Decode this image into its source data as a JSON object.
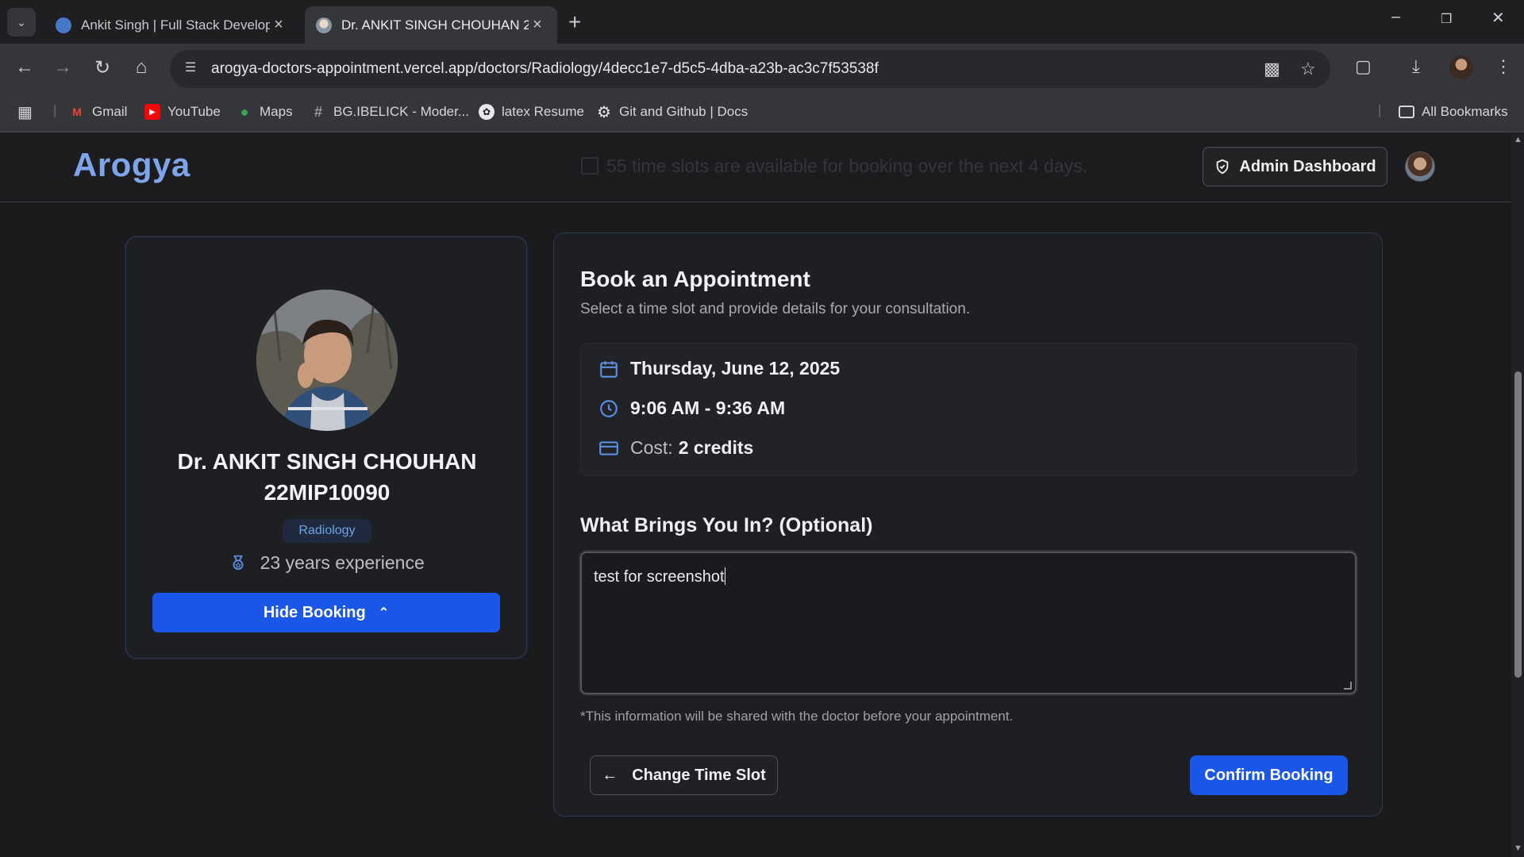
{
  "browser": {
    "tabs": [
      {
        "title": "Ankit Singh | Full Stack Develop",
        "active": false
      },
      {
        "title": "Dr. ANKIT SINGH CHOUHAN 22",
        "active": true
      }
    ],
    "url": "arogya-doctors-appointment.vercel.app/doctors/Radiology/4decc1e7-d5c5-4dba-a23b-ac3c7f53538f",
    "bookmarks": [
      {
        "label": "Gmail",
        "icon": "gmail-icon"
      },
      {
        "label": "YouTube",
        "icon": "youtube-icon"
      },
      {
        "label": "Maps",
        "icon": "maps-icon"
      },
      {
        "label": "BG.IBELICK - Moder...",
        "icon": "hash-icon"
      },
      {
        "label": "latex Resume",
        "icon": "overleaf-icon"
      },
      {
        "label": "Git and Github | Docs",
        "icon": "gear-icon"
      }
    ],
    "all_bookmarks_label": "All Bookmarks"
  },
  "header": {
    "brand": "Arogya",
    "ghost_text": "55 time slots are available for booking over the next 4 days.",
    "admin_label": "Admin Dashboard"
  },
  "doctor": {
    "name_line1": "Dr. ANKIT SINGH CHOUHAN",
    "name_line2": "22MIP10090",
    "specialty": "Radiology",
    "experience": "23 years experience",
    "hide_label": "Hide Booking"
  },
  "booking": {
    "title": "Book an Appointment",
    "subtitle": "Select a time slot and provide details for your consultation.",
    "date": "Thursday, June 12, 2025",
    "time": "9:06 AM - 9:36 AM",
    "cost_label": "Cost:",
    "cost_value": "2 credits",
    "question": "What Brings You In? (Optional)",
    "description": "test for screenshot",
    "note": "*This information will be shared with the doctor before your appointment.",
    "change_label": "Change Time Slot",
    "confirm_label": "Confirm Booking"
  },
  "colors": {
    "brand": "#7ea5ea",
    "primary_button": "#1a57e8",
    "icon_blue": "#5a8fe0"
  }
}
